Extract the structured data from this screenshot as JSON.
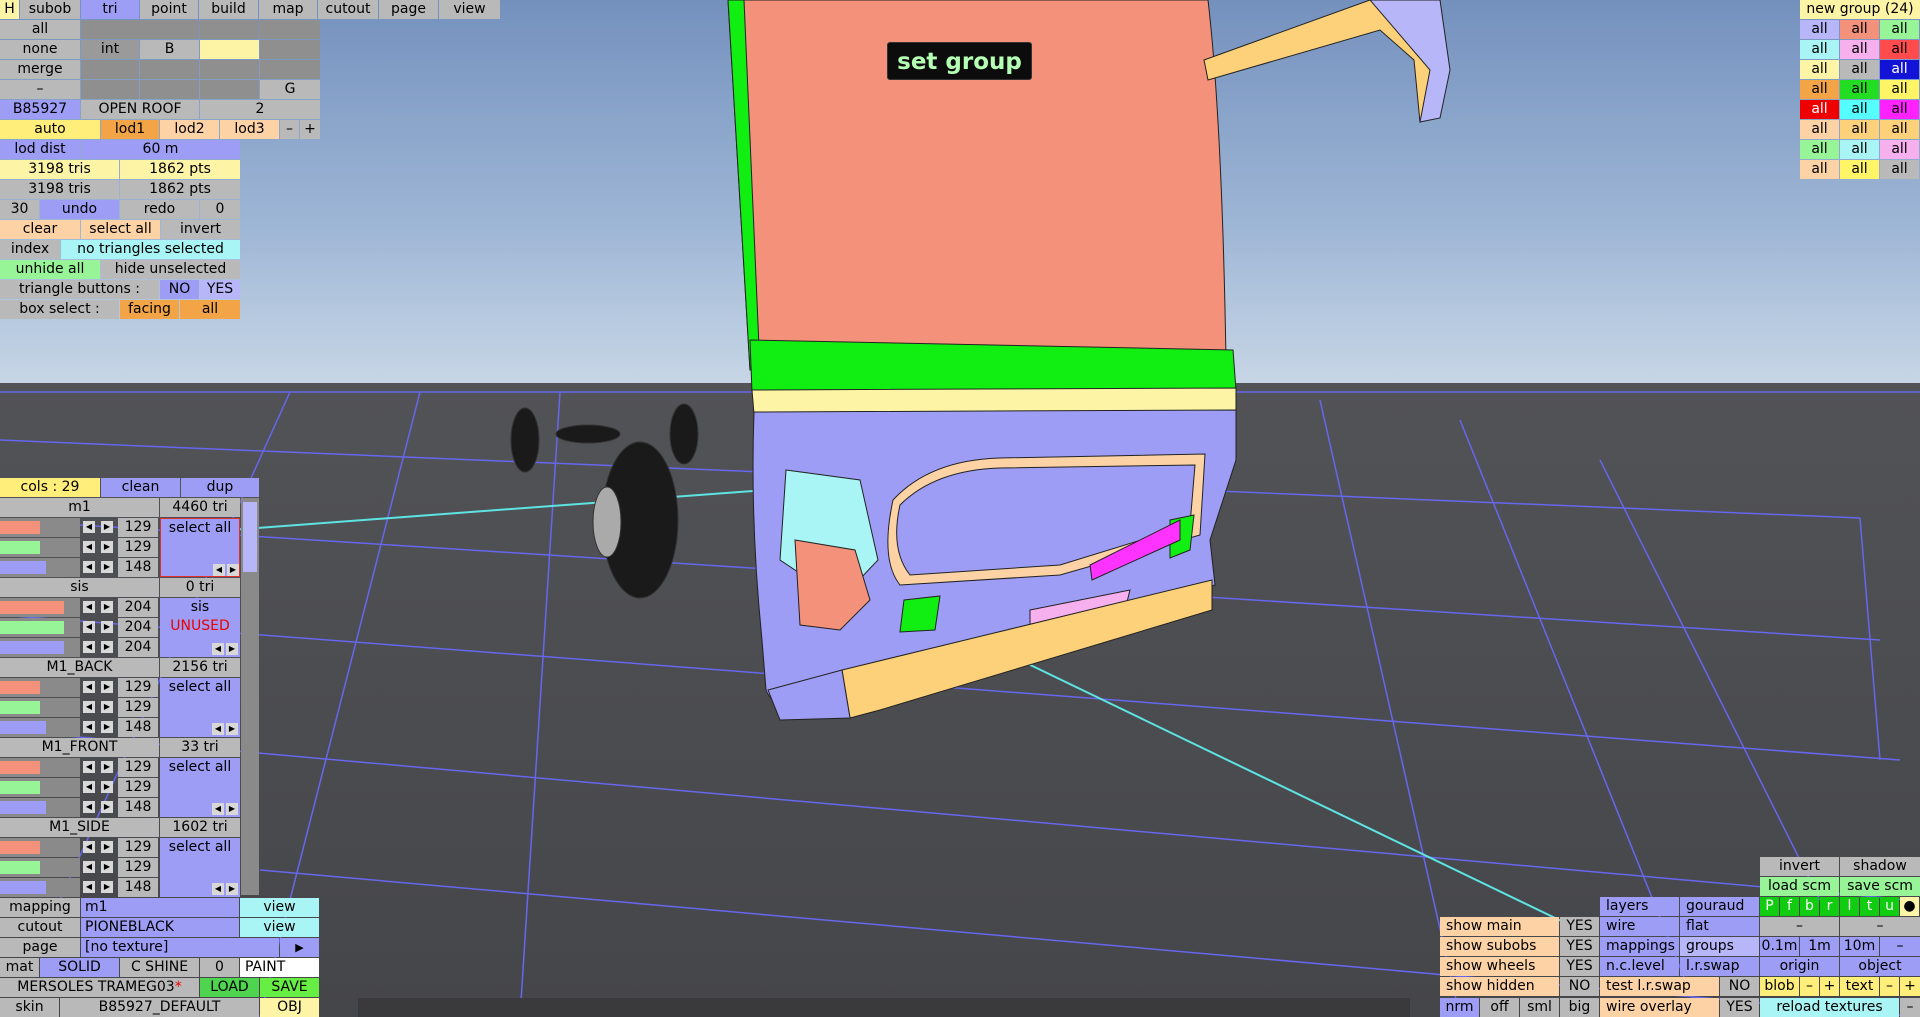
{
  "menu": {
    "h": "H",
    "tabs": [
      "subob",
      "tri",
      "point",
      "build",
      "map",
      "cutout",
      "page",
      "view"
    ]
  },
  "left": {
    "r1": {
      "all": "all"
    },
    "r2": {
      "none": "none",
      "int": "int",
      "b": "B"
    },
    "r3": {
      "merge": "merge"
    },
    "r4": {
      "dash": "–",
      "g": "G"
    },
    "r5": {
      "code": "B85927",
      "name": "OPEN ROOF",
      "num": "2"
    },
    "lod": {
      "auto": "auto",
      "l1": "lod1",
      "l2": "lod2",
      "l3": "lod3",
      "minus": "–",
      "plus": "+"
    },
    "loddist": {
      "label": "lod dist",
      "value": "60 m"
    },
    "tris1": {
      "tris": "3198 tris",
      "pts": "1862 pts"
    },
    "tris2": {
      "tris": "3198 tris",
      "pts": "1862 pts"
    },
    "undo": {
      "n": "30",
      "undo": "undo",
      "redo": "redo",
      "z": "0"
    },
    "sel": {
      "clear": "clear",
      "selall": "select all",
      "invert": "invert"
    },
    "index": {
      "label": "index",
      "status": "no triangles selected"
    },
    "hide": {
      "unhide": "unhide all",
      "hideun": "hide unselected"
    },
    "tribtn": {
      "label": "triangle buttons :",
      "no": "NO",
      "yes": "YES"
    },
    "box": {
      "label": "box select :",
      "facing": "facing",
      "all": "all"
    }
  },
  "cols": {
    "label": "cols : 29",
    "clean": "clean",
    "dup": "dup"
  },
  "materials": [
    {
      "name": "m1",
      "tri": "4460 tri",
      "v": [
        "129",
        "129",
        "148"
      ],
      "act": "select all",
      "sub": ""
    },
    {
      "name": "sis",
      "tri": "0 tri",
      "v": [
        "204",
        "204",
        "204"
      ],
      "act": "sis",
      "sub": "UNUSED"
    },
    {
      "name": "M1_BACK",
      "tri": "2156 tri",
      "v": [
        "129",
        "129",
        "148"
      ],
      "act": "select all",
      "sub": ""
    },
    {
      "name": "M1_FRONT",
      "tri": "33 tri",
      "v": [
        "129",
        "129",
        "148"
      ],
      "act": "select all",
      "sub": ""
    },
    {
      "name": "M1_SIDE",
      "tri": "1602 tri",
      "v": [
        "129",
        "129",
        "148"
      ],
      "act": "select all",
      "sub": ""
    }
  ],
  "bottom": {
    "mapping": {
      "label": "mapping",
      "value": "m1",
      "btn": "view"
    },
    "cutout": {
      "label": "cutout",
      "value": "PIONEBLACK",
      "btn": "view"
    },
    "page": {
      "label": "page",
      "value": "[no texture]",
      "btn": "▶"
    },
    "mat": {
      "label": "mat",
      "solid": "SOLID",
      "cshine": "C SHINE",
      "zero": "0",
      "paint": "PAINT"
    },
    "file": {
      "name": "MERSOLES TRAMEG03",
      "star": "*",
      "load": "LOAD",
      "save": "SAVE"
    },
    "skin": {
      "label": "skin",
      "value": "B85927_DEFAULT",
      "obj": "OBJ"
    }
  },
  "viewport": {
    "tooltip": "set group"
  },
  "groups": {
    "title": "new group (24)",
    "cell": "all"
  },
  "br": {
    "invert": "invert",
    "shadow": "shadow",
    "loadscm": "load scm",
    "savescm": "save scm",
    "letters": [
      "P",
      "f",
      "b",
      "r",
      "l",
      "t",
      "u",
      "●"
    ],
    "dash": "–",
    "showmain": "show main",
    "showsubobs": "show subobs",
    "showwheels": "show wheels",
    "showhidden": "show hidden",
    "yes": "YES",
    "no": "NO",
    "layers": "layers",
    "gouraud": "gouraud",
    "wire": "wire",
    "flat": "flat",
    "mappings": "mappings",
    "grps": "groups",
    "nclevel": "n.c.level",
    "lrswap": "l.r.swap",
    "testlr": "test l.r.swap",
    "wireov": "wire overlay",
    "s01": "0.1m",
    "s1": "1m",
    "s10": "10m",
    "origin": "origin",
    "object": "object",
    "blob": "blob",
    "minus": "–",
    "plus": "+",
    "text": "text",
    "nrm": "nrm",
    "off": "off",
    "sml": "sml",
    "big": "big",
    "reload": "reload textures"
  },
  "colors": {
    "accent": "#9d9df5",
    "grid": "#6666ee",
    "salmon": "#f4917a",
    "green": "#11ee11"
  }
}
